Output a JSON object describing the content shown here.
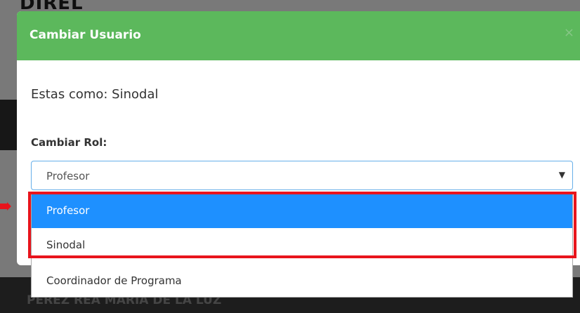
{
  "background": {
    "logo_text": "DIREL",
    "person_name": "PEREZ REA MARIA DE LA LUZ"
  },
  "modal": {
    "title": "Cambiar Usuario",
    "close_label": "×",
    "current_role_text": "Estas como: Sinodal",
    "change_role_label": "Cambiar Rol:",
    "header_color": "#5cb85c"
  },
  "select": {
    "value": "Profesor",
    "caret": "▼",
    "options": [
      {
        "label": "Profesor",
        "selected": true
      },
      {
        "label": "Sinodal",
        "selected": false
      },
      {
        "label": "Coordinador de Programa",
        "selected": false
      }
    ]
  },
  "colors": {
    "highlight": "#e8141c",
    "selected_option": "#1e90ff"
  }
}
